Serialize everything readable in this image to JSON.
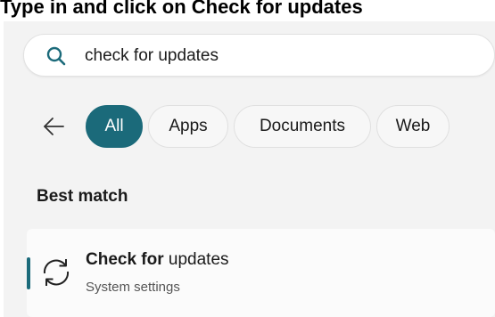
{
  "caption": {
    "prefix": "Type in and click on ",
    "emphasis": "Check for updates"
  },
  "search": {
    "icon": "search-icon",
    "value": "check for updates",
    "accent": "#1b6a7a"
  },
  "filters": {
    "back_icon": "arrow-left-icon",
    "items": [
      {
        "label": "All",
        "active": true
      },
      {
        "label": "Apps",
        "active": false
      },
      {
        "label": "Documents",
        "active": false
      },
      {
        "label": "Web",
        "active": false
      }
    ]
  },
  "best_match": {
    "title": "Best match",
    "result": {
      "icon": "refresh-icon",
      "title_bold": "Check for",
      "title_rest": " updates",
      "subtitle": "System settings"
    }
  },
  "colors": {
    "accent": "#1b6a7a",
    "panel_bg": "#f3f3f3",
    "card_bg": "#fbfbfb"
  }
}
